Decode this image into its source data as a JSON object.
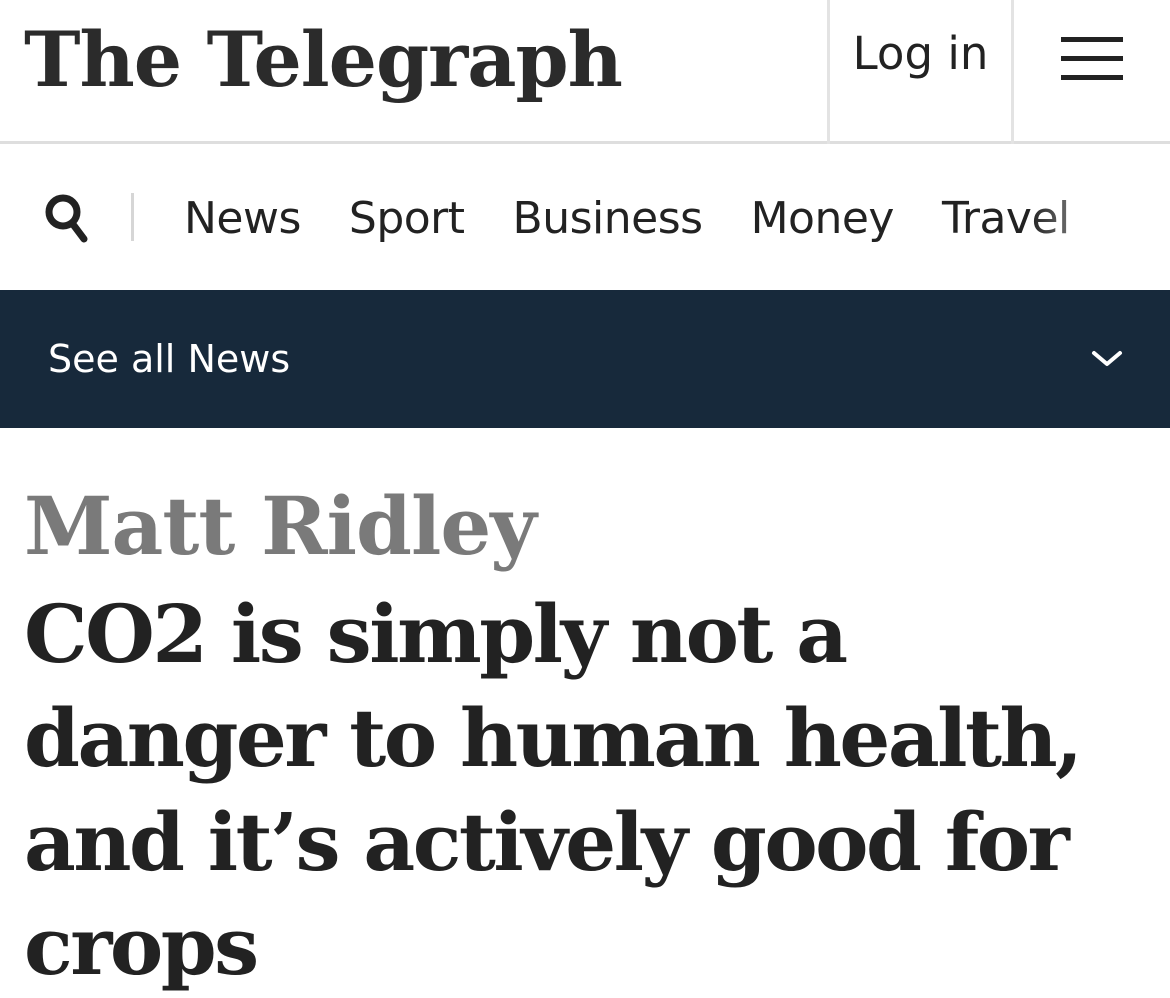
{
  "header": {
    "logo_text": "The Telegraph",
    "login_label": "Log in",
    "menu_icon": "hamburger-menu-icon"
  },
  "nav": {
    "search_icon": "search-icon",
    "items": [
      {
        "label": "News"
      },
      {
        "label": "Sport"
      },
      {
        "label": "Business"
      },
      {
        "label": "Money"
      },
      {
        "label": "Travel"
      }
    ]
  },
  "section_bar": {
    "label": "See all News",
    "icon": "chevron-down-icon",
    "background": "#17293b"
  },
  "article": {
    "byline": "Matt Ridley",
    "headline": "CO2 is simply not a danger to human health, and it’s actively good for crops"
  }
}
